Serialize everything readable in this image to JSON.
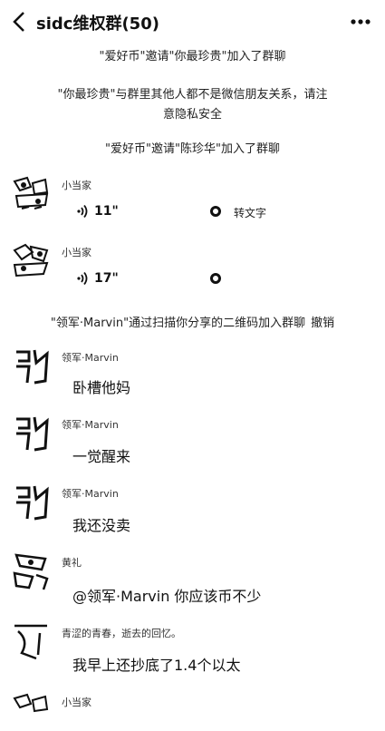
{
  "header": {
    "title": "sidc维权群(50)"
  },
  "system_messages": [
    "\"爱好币\"邀请\"你最珍贵\"加入了群聊",
    "\"你最珍贵\"与群里其他人都不是微信朋友关系，请注意隐私安全",
    "\"爱好币\"邀请\"陈珍华\"加入了群聊"
  ],
  "voice_messages": [
    {
      "sender": "小当家",
      "duration": "11\"",
      "convert_label": "转文字"
    },
    {
      "sender": "小当家",
      "duration": "17\""
    }
  ],
  "join_notice": {
    "text": "\"领军·Marvin\"通过扫描你分享的二维码加入群聊",
    "action": "撤销"
  },
  "text_messages": [
    {
      "sender": "领军·Marvin",
      "text": "卧槽他妈"
    },
    {
      "sender": "领军·Marvin",
      "text": "一觉醒来"
    },
    {
      "sender": "领军·Marvin",
      "text": "我还没卖"
    },
    {
      "sender": "黄礼",
      "text": "@领军·Marvin 你应该币不少"
    },
    {
      "sender": "青涩的青春，逝去的回忆。",
      "text": "我早上还抄底了1.4个以太"
    }
  ],
  "last_sender": "小当家"
}
